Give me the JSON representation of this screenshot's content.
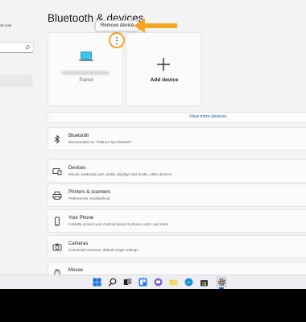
{
  "sidebar": {
    "account_email": "ok.com",
    "search_placeholder": ""
  },
  "page_title": "Bluetooth & devices",
  "tooltip": {
    "label": "Remove device"
  },
  "device_card": {
    "status": "Paired"
  },
  "add_card": {
    "label": "Add device"
  },
  "view_more": {
    "label": "View more devices"
  },
  "settings_rows": [
    {
      "title": "Bluetooth",
      "description": "Discoverable as \"TABLET-Q1ADUKSK\"",
      "icon": "bluetooth-icon"
    },
    {
      "title": "Devices",
      "description": "Mouse, keyboard, pen, audio, displays and docks, other devices",
      "icon": "devices-icon"
    },
    {
      "title": "Printers & scanners",
      "description": "Preferences, troubleshoot",
      "icon": "printer-icon"
    },
    {
      "title": "Your Phone",
      "description": "Instantly access your Android device's photos, texts, and more",
      "icon": "phone-icon"
    },
    {
      "title": "Cameras",
      "description": "Connected cameras, default image settings",
      "icon": "camera-icon"
    },
    {
      "title": "Mouse",
      "description": "",
      "icon": "mouse-icon"
    }
  ],
  "taskbar": {
    "items": [
      "windows-start-icon",
      "search-icon",
      "task-view-icon",
      "widgets-icon",
      "chat-icon",
      "file-explorer-icon",
      "edge-icon",
      "store-icon",
      "settings-icon"
    ]
  },
  "colors": {
    "accent": "#0067c0",
    "highlight": "#f5a623",
    "link": "#1a5fb4"
  }
}
